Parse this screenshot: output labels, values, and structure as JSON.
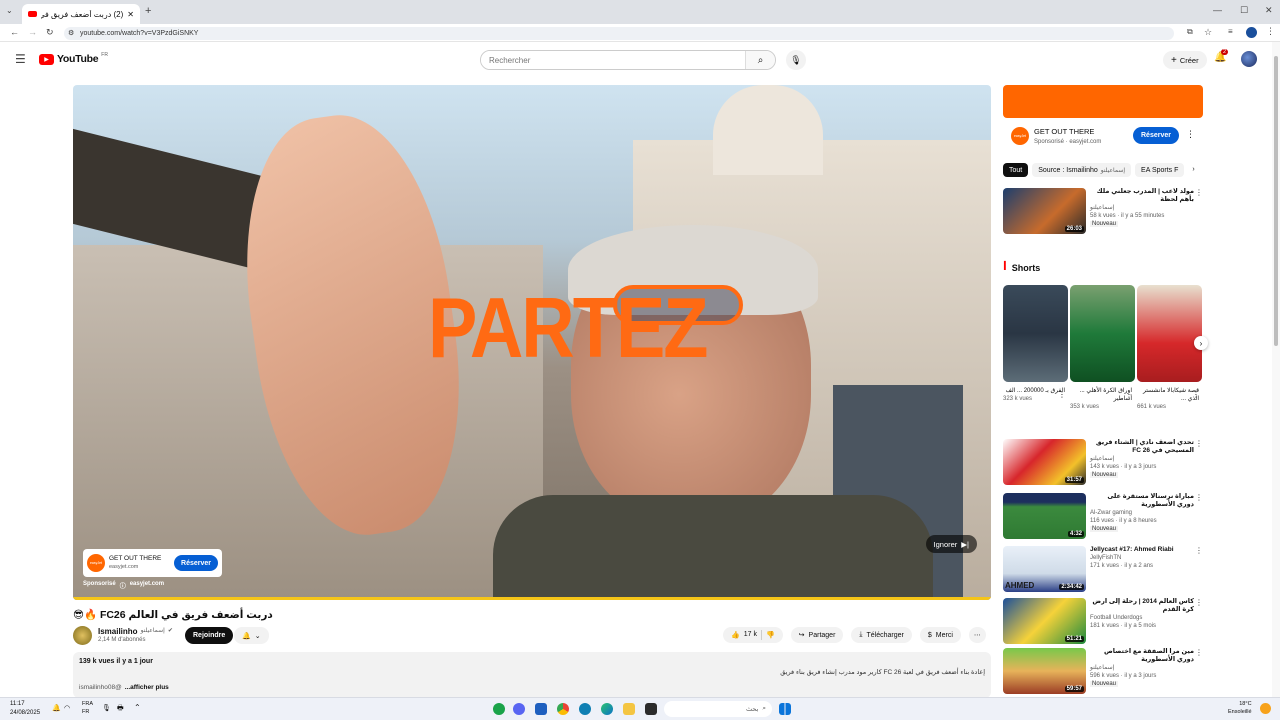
{
  "browser": {
    "tab_title": "(2) دربت أضعف فريق في ال...",
    "url": "youtube.com/watch?v=V3PzdGiSNKY"
  },
  "header": {
    "logo_text": "YouTube",
    "logo_region": "FR",
    "search_placeholder": "Rechercher",
    "create_label": "Créer",
    "notification_count": "2"
  },
  "player": {
    "overlay_text": "PARTEZ",
    "ad_title": "GET OUT THERE",
    "ad_domain": "easyjet.com",
    "ad_button": "Réserver",
    "ad_brand": "easyJet",
    "sponsored_label": "Sponsorisé",
    "sponsored_domain": "easyjet.com",
    "skip_label": "Ignorer",
    "progress_fraction": 1.0
  },
  "video": {
    "title": "دربت أضعف فريق في العالم FC26 🔥😎",
    "channel_name": "Ismailinho",
    "channel_arabic": "إسماعيلنو",
    "subscribers": "2,14 M d'abonnés",
    "join_label": "Rejoindre",
    "likes": "17 k",
    "share_label": "Partager",
    "download_label": "Télécharger",
    "thanks_label": "Merci",
    "views_date": "139 k vues  il y a 1 jour",
    "desc_line": "إعادة بناء أضعف فريق في لعبة FC 26 كارير مود مدرب إنشاء فريق بناء فريق",
    "desc_more_prefix": "ismailinho08@",
    "desc_more": "...afficher plus"
  },
  "sidebar": {
    "ad_title": "GET OUT THERE",
    "ad_sponsored": "Sponsorisé · easyjet.com",
    "ad_button": "Réserver",
    "ad_logo": "easyJet",
    "chips": [
      "Tout",
      "Source : Ismailinho",
      "إسماعيلنو",
      "EA Sports F"
    ],
    "top_rec": {
      "title": "مولد لاعب | المدرب جعلني ملك بأهم لحظة",
      "channel": "إسماعيلنو",
      "stats": "58 k vues · il y a 55 minutes",
      "badge": "Nouveau",
      "duration": "26:03"
    },
    "shorts_heading": "Shorts",
    "shorts": [
      {
        "title": "الفرق بـ 200000 ... الف",
        "views": "323 k vues"
      },
      {
        "title": "اوراق الكرة الأهلي ... أساطير",
        "views": "353 k vues"
      },
      {
        "title": "قصة شيكابالا مانشستر الذي ...",
        "views": "661 k vues"
      }
    ],
    "recs": [
      {
        "title": "تحدي أضعف نادي | الشتاء فريق المسيحي في FC 26",
        "channel": "إسماعيلنو",
        "stats": "143 k vues · il y a 3 jours",
        "badge": "Nouveau",
        "duration": "31:57"
      },
      {
        "title": "مباراة نرسنالا مستقرة على دوري الأسطورية",
        "channel": "Al-Zwar gaming",
        "stats": "116 vues · il y a 8 heures",
        "badge": "Nouveau",
        "duration": "4:32"
      },
      {
        "title": "Jellycast #17: Ahmed Riabi",
        "channel": "JellyFishTN",
        "stats": "171 k vues · il y a 2 ans",
        "badge": "",
        "duration": "2:34:42"
      },
      {
        "title": "كأس العالم 2014 | رحلة إلى أرض كرة القدم",
        "channel": "Football Underdogs",
        "stats": "181 k vues · il y a 5 mois",
        "badge": "",
        "duration": "51:21"
      },
      {
        "title": "مين مرا الصفقة مع اختصاص دوري الأسطورية",
        "channel": "إسماعيلنو",
        "stats": "596 k vues · il y a 3 jours",
        "badge": "Nouveau",
        "duration": "59:57"
      }
    ]
  },
  "taskbar": {
    "time": "11:17",
    "date": "24/08/2025",
    "lang": "FRA",
    "lang_sub": "FR",
    "search_placeholder": "بحث",
    "weather": "18°C",
    "weather_sub": "Ensoleillé"
  },
  "colors": {
    "youtube_red": "#ff0000",
    "easyjet_orange": "#ff6600",
    "reserve_blue": "#065fd4",
    "progress_yellow": "#f5c518"
  }
}
